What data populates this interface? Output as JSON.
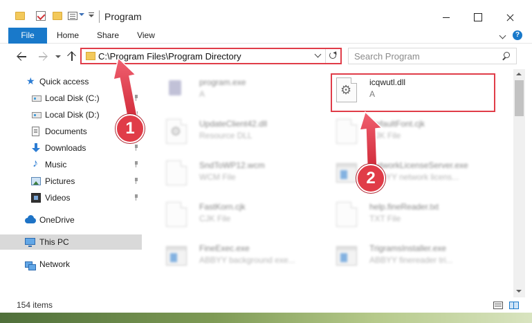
{
  "window": {
    "title": "Program",
    "controls": {
      "minimize": "minimize-icon",
      "maximize": "maximize-icon",
      "close": "close-icon"
    }
  },
  "ribbon": {
    "tabs": [
      {
        "label": "File",
        "active": true
      },
      {
        "label": "Home"
      },
      {
        "label": "Share"
      },
      {
        "label": "View"
      }
    ],
    "help_label": "?"
  },
  "navigation": {
    "address": "C:\\Program Files\\Program Directory",
    "search_placeholder": "Search Program"
  },
  "sidebar": {
    "items": [
      {
        "label": "Quick access",
        "icon": "star-icon",
        "pinned": false
      },
      {
        "label": "Local Disk (C:)",
        "icon": "drive-icon",
        "pinned": true
      },
      {
        "label": "Local Disk (D:)",
        "icon": "drive-icon",
        "pinned": true
      },
      {
        "label": "Documents",
        "icon": "documents-icon",
        "pinned": true
      },
      {
        "label": "Downloads",
        "icon": "downloads-icon",
        "pinned": true
      },
      {
        "label": "Music",
        "icon": "music-icon",
        "pinned": true
      },
      {
        "label": "Pictures",
        "icon": "pictures-icon",
        "pinned": true
      },
      {
        "label": "Videos",
        "icon": "videos-icon",
        "pinned": true
      },
      {
        "label": "OneDrive",
        "icon": "onedrive-icon",
        "pinned": false
      },
      {
        "label": "This PC",
        "icon": "computer-icon",
        "selected": true
      },
      {
        "label": "Network",
        "icon": "network-icon",
        "pinned": false
      }
    ]
  },
  "files": [
    {
      "name": "program.exe",
      "type": "A",
      "icon": "setup-icon",
      "blurred": true
    },
    {
      "name": "icqwutl.dll",
      "type": "A",
      "icon": "dll-gear-icon",
      "blurred": false,
      "highlighted": true
    },
    {
      "name": "UpdateClient42.dll",
      "type": "Resource DLL",
      "icon": "dll-gear-icon",
      "blurred": true
    },
    {
      "name": "DefaultFont.cjk",
      "type": "CJK File",
      "icon": "file-icon",
      "blurred": true
    },
    {
      "name": "SndToWP12.wcm",
      "type": "WCM File",
      "icon": "file-icon",
      "blurred": true
    },
    {
      "name": "NetworkLicenseServer.exe",
      "type": "ABBYY network licens...",
      "icon": "exe-icon",
      "blurred": true
    },
    {
      "name": "FastKorn.cjk",
      "type": "CJK File",
      "icon": "file-icon",
      "blurred": true
    },
    {
      "name": "help.fineReader.txt",
      "type": "TXT File",
      "icon": "file-icon",
      "blurred": true
    },
    {
      "name": "FineExec.exe",
      "type": "ABBYY background exe...",
      "icon": "exe-icon",
      "blurred": true
    },
    {
      "name": "TrigramsInstaller.exe",
      "type": "ABBYY finereader tri...",
      "icon": "exe-icon",
      "blurred": true
    }
  ],
  "status": {
    "item_count": "154 items"
  },
  "annotations": {
    "step1": "1",
    "step2": "2",
    "color": "#e03c48"
  },
  "colors": {
    "accent": "#1979ca",
    "highlight": "#e03c48",
    "selected_bg": "#d9d9d9"
  }
}
